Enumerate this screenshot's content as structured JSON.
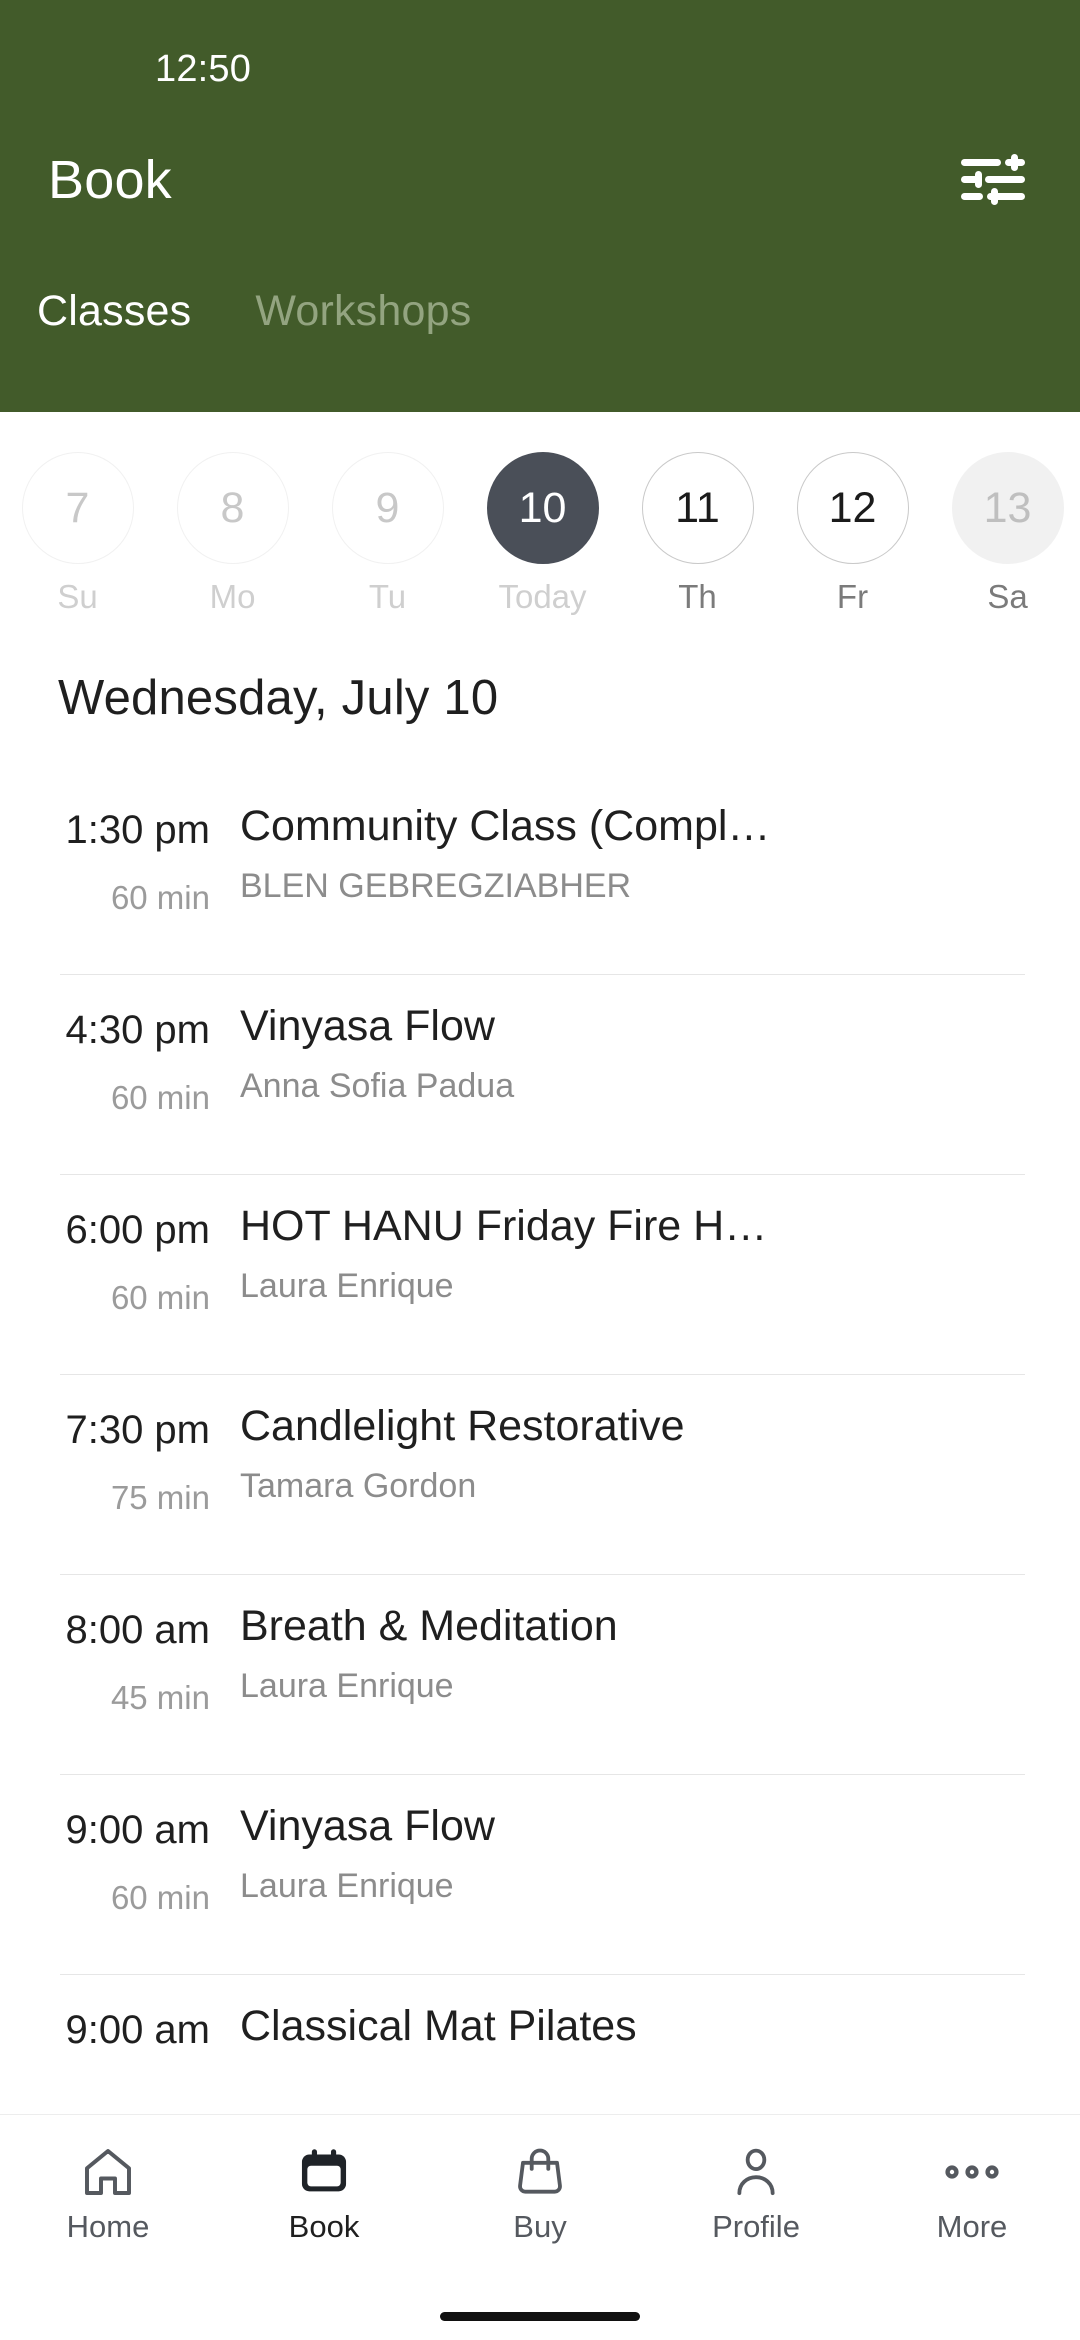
{
  "theme": {
    "header_green": "#425B2A",
    "tab_inactive": "#93A480",
    "today_circle": "#4A4F58",
    "text_primary": "#1f1f1f",
    "text_secondary": "#8c8c8c",
    "divider": "#e6e6e6"
  },
  "statusbar": {
    "time": "12:50"
  },
  "header": {
    "title": "Book",
    "filter_icon": "tune-icon"
  },
  "tabs": [
    {
      "label": "Classes",
      "active": true
    },
    {
      "label": "Workshops",
      "active": false
    }
  ],
  "datestrip": [
    {
      "day": "7",
      "weekday": "Su",
      "state": "past"
    },
    {
      "day": "8",
      "weekday": "Mo",
      "state": "past"
    },
    {
      "day": "9",
      "weekday": "Tu",
      "state": "past"
    },
    {
      "day": "10",
      "weekday": "Today",
      "state": "today"
    },
    {
      "day": "11",
      "weekday": "Th",
      "state": "future"
    },
    {
      "day": "12",
      "weekday": "Fr",
      "state": "future"
    },
    {
      "day": "13",
      "weekday": "Sa",
      "state": "disabled"
    }
  ],
  "schedule": {
    "day_heading": "Wednesday, July 10",
    "items": [
      {
        "time": "1:30 pm",
        "duration": "60 min",
        "name": "Community Class (Compl…",
        "teacher": "BLEN GEBREGZIABHER"
      },
      {
        "time": "4:30 pm",
        "duration": "60 min",
        "name": "Vinyasa Flow",
        "teacher": "Anna Sofia Padua"
      },
      {
        "time": "6:00 pm",
        "duration": "60 min",
        "name": "HOT HANU Friday Fire H…",
        "teacher": "Laura Enrique"
      },
      {
        "time": "7:30 pm",
        "duration": "75 min",
        "name": "Candlelight Restorative",
        "teacher": "Tamara Gordon"
      },
      {
        "time": "8:00 am",
        "duration": "45 min",
        "name": "Breath & Meditation",
        "teacher": "Laura Enrique"
      },
      {
        "time": "9:00 am",
        "duration": "60 min",
        "name": "Vinyasa Flow",
        "teacher": "Laura Enrique"
      },
      {
        "time": "9:00 am",
        "duration": "",
        "name": "Classical Mat Pilates",
        "teacher": ""
      }
    ]
  },
  "bottomnav": [
    {
      "label": "Home",
      "icon": "house-icon",
      "active": false
    },
    {
      "label": "Book",
      "icon": "calendar-icon",
      "active": true
    },
    {
      "label": "Buy",
      "icon": "bag-icon",
      "active": false
    },
    {
      "label": "Profile",
      "icon": "person-icon",
      "active": false
    },
    {
      "label": "More",
      "icon": "ellipsis-icon",
      "active": false
    }
  ]
}
